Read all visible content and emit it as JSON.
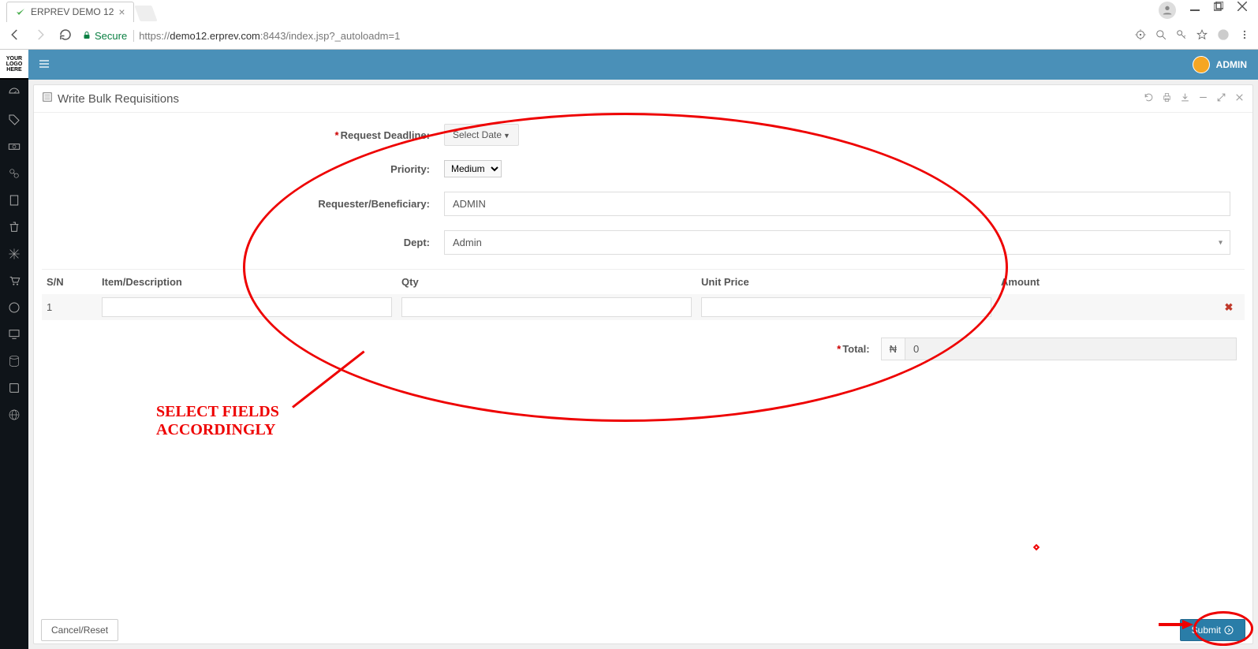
{
  "browser": {
    "tab_title": "ERPREV DEMO 12",
    "secure_label": "Secure",
    "url_scheme": "https://",
    "url_host": "demo12.erprev.com",
    "url_port_path": ":8443/index.jsp?_autoloadm=1"
  },
  "topbar": {
    "logo_line1": "YOUR",
    "logo_line2": "LOGO",
    "logo_line3": "HERE",
    "user_label": "ADMIN"
  },
  "panel": {
    "title": "Write Bulk Requisitions"
  },
  "form": {
    "request_deadline_label": "Request Deadline:",
    "request_deadline_value": "Select Date",
    "priority_label": "Priority:",
    "priority_value": "Medium",
    "requester_label": "Requester/Beneficiary:",
    "requester_value": "ADMIN",
    "dept_label": "Dept:",
    "dept_value": "Admin"
  },
  "table": {
    "headers": {
      "sn": "S/N",
      "desc": "Item/Description",
      "qty": "Qty",
      "unit_price": "Unit Price",
      "amount": "Amount"
    },
    "rows": [
      {
        "sn": "1",
        "desc": "",
        "qty": "",
        "unit_price": "",
        "amount": ""
      }
    ]
  },
  "totals": {
    "label": "Total:",
    "currency": "₦",
    "value": "0"
  },
  "buttons": {
    "cancel": "Cancel/Reset",
    "submit": "Submit"
  },
  "annotation": {
    "text_line1": "SELECT FIELDS",
    "text_line2": "ACCORDINGLY"
  }
}
